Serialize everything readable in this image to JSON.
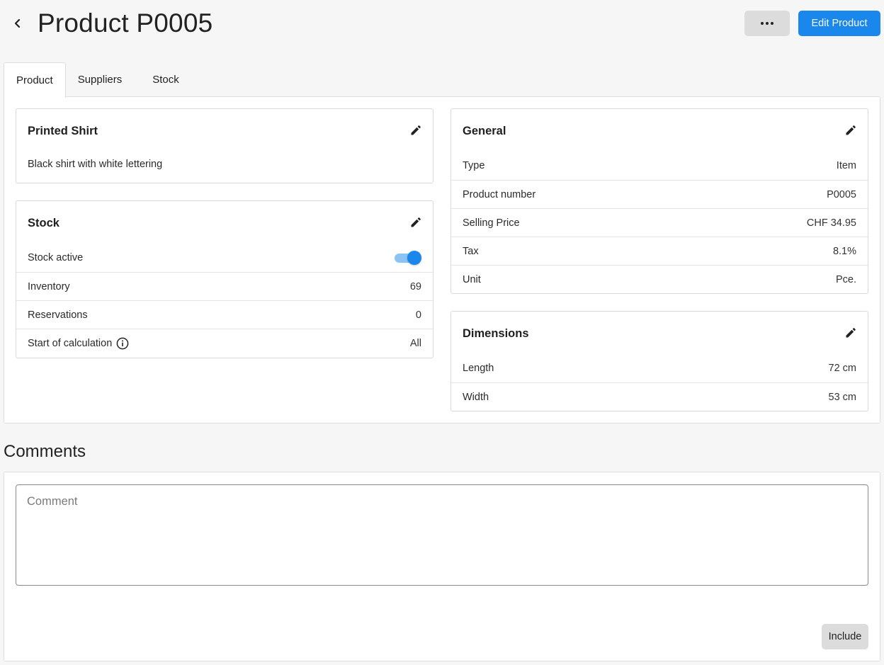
{
  "header": {
    "title": "Product P0005",
    "more_label": "···",
    "edit_label": "Edit Product"
  },
  "tabs": [
    {
      "label": "Product",
      "active": true
    },
    {
      "label": "Suppliers",
      "active": false
    },
    {
      "label": "Stock",
      "active": false
    }
  ],
  "description_card": {
    "title": "Printed Shirt",
    "text": "Black shirt with white lettering"
  },
  "stock_card": {
    "title": "Stock",
    "rows": [
      {
        "label": "Stock active",
        "toggle_on": true
      },
      {
        "label": "Inventory",
        "value": "69"
      },
      {
        "label": "Reservations",
        "value": "0"
      },
      {
        "label": "Start of calculation",
        "value": "All",
        "info_icon": "info-icon"
      }
    ]
  },
  "general_card": {
    "title": "General",
    "rows": [
      {
        "label": "Type",
        "value": "Item"
      },
      {
        "label": "Product number",
        "value": "P0005"
      },
      {
        "label": "Selling Price",
        "value": "CHF 34.95"
      },
      {
        "label": "Tax",
        "value": "8.1%"
      },
      {
        "label": "Unit",
        "value": "Pce."
      }
    ]
  },
  "dimensions_card": {
    "title": "Dimensions",
    "rows": [
      {
        "label": "Length",
        "value": "72 cm"
      },
      {
        "label": "Width",
        "value": "53 cm"
      }
    ]
  },
  "comments": {
    "title": "Comments",
    "placeholder": "Comment",
    "value": "",
    "submit_label": "Include"
  },
  "colors": {
    "accent": "#1a87ec",
    "toggle_track": "#8cc3f5",
    "background": "#f6f6f6",
    "button_gray": "#dcdcdc"
  },
  "icons": {
    "back": "chevron-left-icon",
    "more": "ellipsis-icon",
    "edit": "pencil-icon",
    "info": "info-icon"
  }
}
